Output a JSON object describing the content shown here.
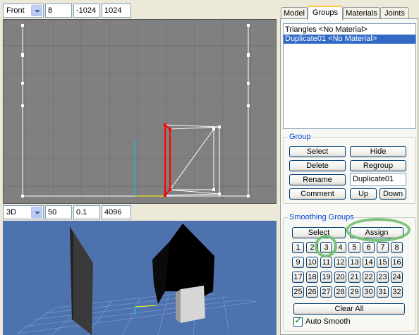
{
  "top_toolbar": {
    "view_select": "Front",
    "field1": "8",
    "field2": "-1024",
    "field3": "1024"
  },
  "mid_toolbar": {
    "view_select": "3D",
    "field1": "50",
    "field2": "0.1",
    "field3": "4096"
  },
  "tabs": [
    "Model",
    "Groups",
    "Materials",
    "Joints"
  ],
  "active_tab": "Groups",
  "groups_list": [
    {
      "label": "Triangles <No Material>",
      "selected": false
    },
    {
      "label": "Duplicate01 <No Material>",
      "selected": true
    }
  ],
  "group_box": {
    "title": "Group",
    "select": "Select",
    "hide": "Hide",
    "delete": "Delete",
    "regroup": "Regroup",
    "rename": "Rename",
    "name_value": "Duplicate01",
    "comment": "Comment",
    "up": "Up",
    "down": "Down"
  },
  "smoothing_box": {
    "title": "Smoothing Groups",
    "select": "Select",
    "assign": "Assign",
    "numbers": [
      "1",
      "2",
      "3",
      "4",
      "5",
      "6",
      "7",
      "8",
      "9",
      "10",
      "11",
      "12",
      "13",
      "14",
      "15",
      "16",
      "17",
      "18",
      "19",
      "20",
      "21",
      "22",
      "23",
      "24",
      "25",
      "26",
      "27",
      "28",
      "29",
      "30",
      "31",
      "32"
    ],
    "clear_all": "Clear All",
    "auto_smooth": "Auto Smooth",
    "auto_smooth_checked": true
  },
  "colors": {
    "highlight_ring": "#6fbf6f",
    "selection": "#316ac5",
    "selected_edges": "#ff0000",
    "grid_bg": "#808080"
  }
}
